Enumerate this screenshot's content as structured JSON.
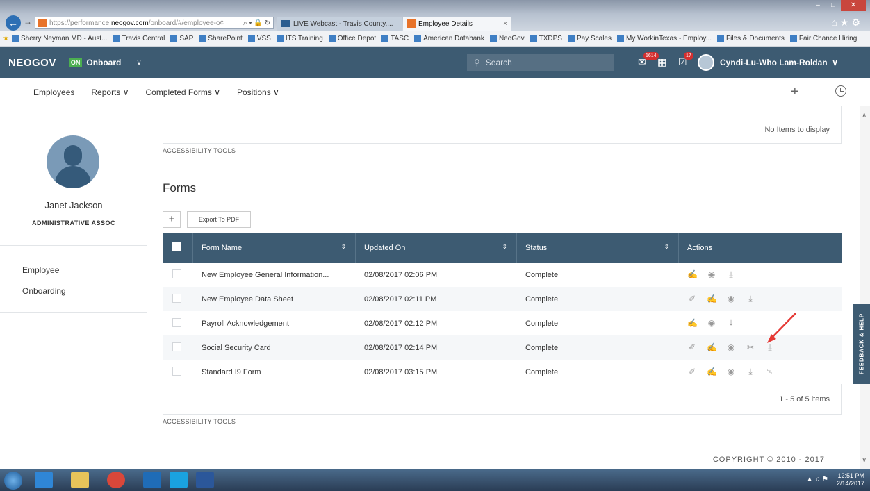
{
  "browser": {
    "url_prefix": "https://performance.",
    "url_domain": "neogov.com",
    "url_path": "/onboard/#/employee-o¢",
    "url_icons": "⌕ ▾ 🔒 ↻",
    "tabs": [
      {
        "label": "LIVE Webcast - Travis County,..."
      },
      {
        "label": "Employee Details",
        "close": "×"
      }
    ],
    "favorites": [
      "Sherry Neyman MD - Aust...",
      "Travis Central",
      "SAP",
      "SharePoint",
      "VSS",
      "ITS Training",
      "Office Depot",
      "TASC",
      "American Databank",
      "NeoGov",
      "TXDPS",
      "Pay Scales",
      "My WorkinTexas - Employ...",
      "Files & Documents",
      "Fair Chance Hiring"
    ]
  },
  "header": {
    "brand": "NEOGOV",
    "product_badge": "ON",
    "product_name": "Onboard",
    "search_placeholder": "Search",
    "inbox_badge": "1614",
    "tasks_badge": "17",
    "user_name": "Cyndi-Lu-Who Lam-Roldan"
  },
  "subnav": {
    "items": [
      "Employees",
      "Reports ∨",
      "Completed Forms ∨",
      "Positions ∨"
    ]
  },
  "sidebar": {
    "name": "Janet Jackson",
    "role": "ADMINISTRATIVE ASSOC",
    "links": [
      "Employee",
      "Onboarding"
    ]
  },
  "main": {
    "no_items": "No Items to display",
    "accessibility_tools": "ACCESSIBILITY TOOLS",
    "forms_title": "Forms",
    "add_label": "+",
    "export_label": "Export To PDF",
    "columns": {
      "form_name": "Form Name",
      "updated_on": "Updated On",
      "status": "Status",
      "actions": "Actions"
    },
    "rows": [
      {
        "name": "New Employee General Information...",
        "updated": "02/08/2017 02:06 PM",
        "status": "Complete",
        "actions": [
          "sign",
          "view",
          "download"
        ]
      },
      {
        "name": "New Employee Data Sheet",
        "updated": "02/08/2017 02:11 PM",
        "status": "Complete",
        "actions": [
          "edit",
          "sign",
          "view",
          "download"
        ]
      },
      {
        "name": "Payroll Acknowledgement",
        "updated": "02/08/2017 02:12 PM",
        "status": "Complete",
        "actions": [
          "sign",
          "view",
          "download"
        ]
      },
      {
        "name": "Social Security Card",
        "updated": "02/08/2017 02:14 PM",
        "status": "Complete",
        "actions": [
          "edit",
          "sign",
          "view",
          "attach",
          "download"
        ]
      },
      {
        "name": "Standard I9 Form",
        "updated": "02/08/2017 03:15 PM",
        "status": "Complete",
        "actions": [
          "edit",
          "sign",
          "view",
          "download",
          "delete"
        ]
      }
    ],
    "pager_info": "1 - 5 of 5 items",
    "copyright": "COPYRIGHT © 2010 - 2017"
  },
  "feedback": "FEEDBACK & HELP",
  "taskbar": {
    "time": "12:51 PM",
    "date": "2/14/2017"
  },
  "action_icons": {
    "edit": "✐",
    "sign": "✍",
    "view": "◉",
    "attach": "✂",
    "download": "⤓",
    "delete": "␡"
  },
  "colors": {
    "header_bg": "#3d5b72",
    "annotation_arrow": "#e53935",
    "badge_green": "#4caf50"
  }
}
